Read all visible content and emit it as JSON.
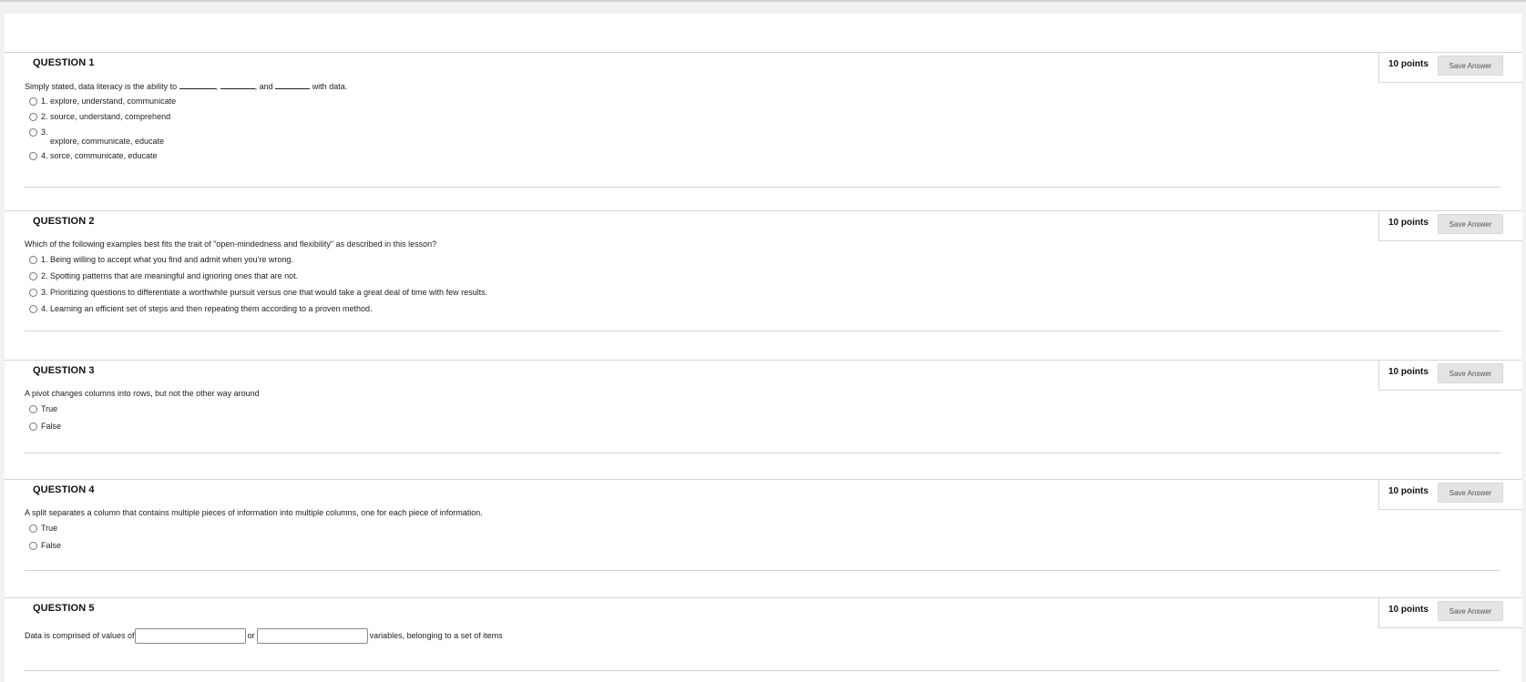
{
  "questions": [
    {
      "title": "QUESTION 1",
      "points": "10 points",
      "save_label": "Save Answer",
      "prompt_start": "Simply stated, data literacy is the ability to",
      "prompt_sep1": ",",
      "prompt_sep2": ", and",
      "prompt_end": "with data.",
      "options": [
        {
          "num": "1.",
          "text": "explore, understand, communicate"
        },
        {
          "num": "2.",
          "text": "source, understand, comprehend"
        },
        {
          "num": "3.",
          "text": "explore, communicate, educate"
        },
        {
          "num": "4.",
          "text": "sorce, communicate, educate"
        }
      ]
    },
    {
      "title": "QUESTION 2",
      "points": "10 points",
      "save_label": "Save Answer",
      "prompt": "Which of the following examples best fits the trait of \"open-mindedness and flexibility\" as described in this lesson?",
      "options": [
        {
          "num": "1.",
          "text": "Being willing to accept what you find and admit when you're wrong."
        },
        {
          "num": "2.",
          "text": "Spotting patterns that are meaningful and ignoring ones that are not."
        },
        {
          "num": "3.",
          "text": "Prioritizing questions to differentiate a worthwhile pursuit versus one that would take a great deal of time with few results."
        },
        {
          "num": "4.",
          "text": "Learning an efficient set of steps and then repeating them according to a proven method."
        }
      ]
    },
    {
      "title": "QUESTION 3",
      "points": "10 points",
      "save_label": "Save Answer",
      "prompt": "A pivot changes columns into rows, but not the other way around",
      "options": [
        {
          "text": "True"
        },
        {
          "text": "False"
        }
      ]
    },
    {
      "title": "QUESTION 4",
      "points": "10 points",
      "save_label": "Save Answer",
      "prompt": "A split separates a column that contains multiple pieces of information into multiple columns, one for each piece of information.",
      "options": [
        {
          "text": "True"
        },
        {
          "text": "False"
        }
      ]
    },
    {
      "title": "QUESTION 5",
      "points": "10 points",
      "save_label": "Save Answer",
      "prompt_start": "Data is comprised of values of",
      "prompt_mid": "or",
      "prompt_end": "variables, belonging to a set of items",
      "blank1_value": "",
      "blank2_value": ""
    }
  ]
}
